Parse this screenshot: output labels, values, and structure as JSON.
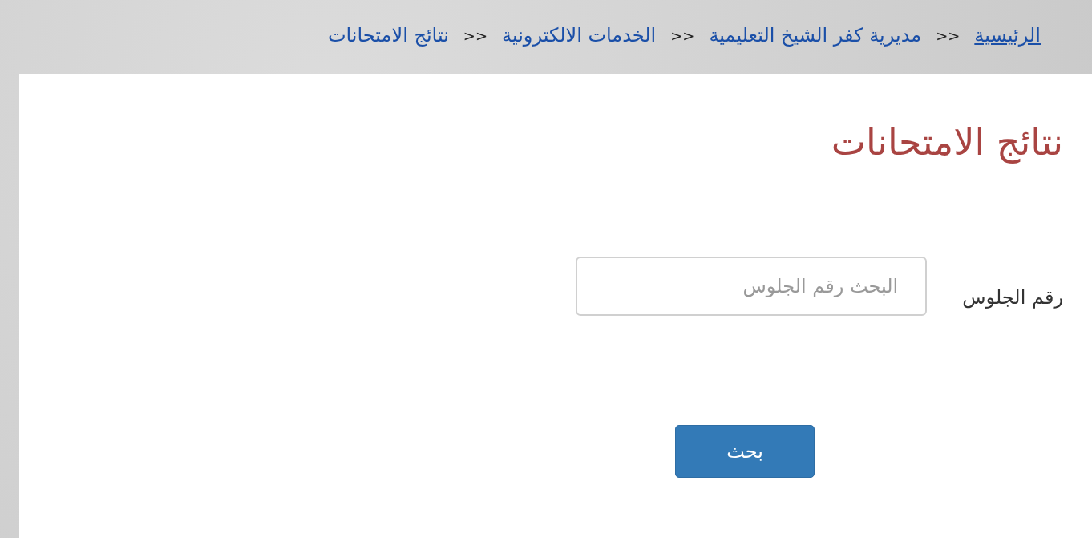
{
  "breadcrumb": [
    {
      "label": "الرئيسية",
      "kind": "link"
    },
    {
      "label": "مديرية كفر الشيخ التعليمية",
      "kind": "item"
    },
    {
      "label": "الخدمات الالكترونية",
      "kind": "item"
    },
    {
      "label": "نتائج الامتحانات",
      "kind": "item"
    }
  ],
  "separator": ">>",
  "title": "نتائج الامتحانات",
  "form": {
    "label": "رقم الجلوس",
    "placeholder": "البحث رقم الجلوس",
    "button": "بحث"
  }
}
